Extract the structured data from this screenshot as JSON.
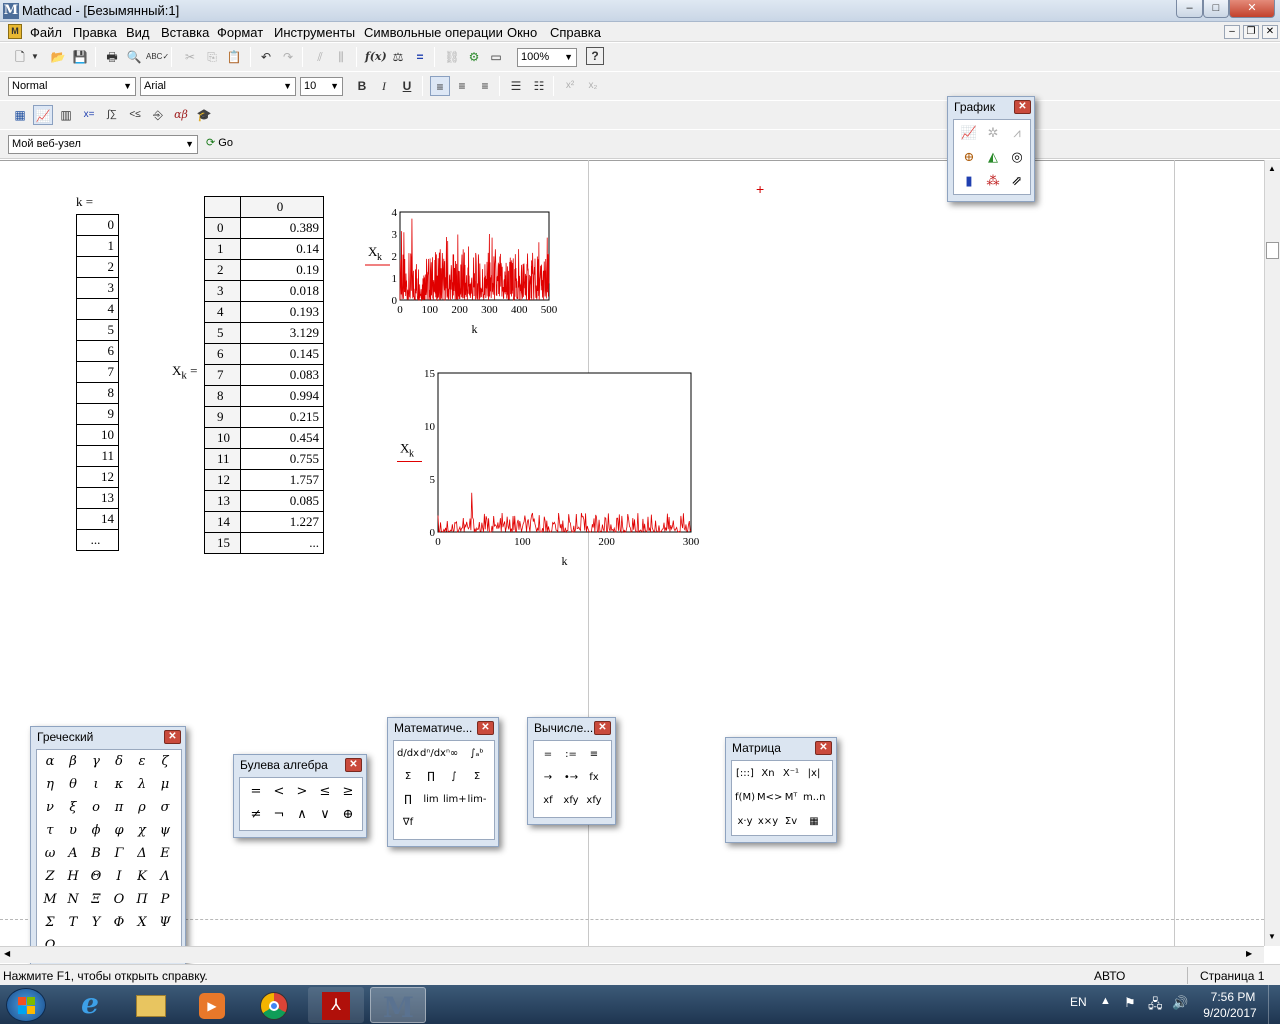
{
  "window": {
    "title": "Mathcad - [Безымянный:1]",
    "app_icon": "M",
    "controls": [
      "–",
      "□",
      "✕"
    ]
  },
  "menu": [
    "Файл",
    "Правка",
    "Вид",
    "Вставка",
    "Формат",
    "Инструменты",
    "Символьные операции",
    "Окно",
    "Справка"
  ],
  "toolbar1": {
    "zoom": "100%"
  },
  "format_bar": {
    "style": "Normal",
    "font": "Arial",
    "size": "10",
    "bold": "B",
    "italic": "I",
    "underline": "U"
  },
  "web_bar": {
    "url": "Мой веб-узел",
    "go": "Go"
  },
  "worksheet": {
    "k_label": "k =",
    "k_values": [
      "0",
      "1",
      "2",
      "3",
      "4",
      "5",
      "6",
      "7",
      "8",
      "9",
      "10",
      "11",
      "12",
      "13",
      "14",
      "..."
    ],
    "x_label": "X",
    "x_sub": "k",
    "x_eq": "=",
    "x_header_row": [
      "",
      "0"
    ],
    "x_rows": [
      [
        "0",
        "0.389"
      ],
      [
        "1",
        "0.14"
      ],
      [
        "2",
        "0.19"
      ],
      [
        "3",
        "0.018"
      ],
      [
        "4",
        "0.193"
      ],
      [
        "5",
        "3.129"
      ],
      [
        "6",
        "0.145"
      ],
      [
        "7",
        "0.083"
      ],
      [
        "8",
        "0.994"
      ],
      [
        "9",
        "0.215"
      ],
      [
        "10",
        "0.454"
      ],
      [
        "11",
        "0.755"
      ],
      [
        "12",
        "1.757"
      ],
      [
        "13",
        "0.085"
      ],
      [
        "14",
        "1.227"
      ],
      [
        "15",
        "..."
      ]
    ]
  },
  "chart_data": [
    {
      "type": "line",
      "xlabel": "k",
      "ylabel": "X",
      "ylabel_sub": "k",
      "xlim": [
        0,
        500
      ],
      "ylim": [
        0,
        4
      ],
      "xticks": [
        "0",
        "100",
        "200",
        "300",
        "400",
        "500"
      ],
      "yticks": [
        "0",
        "1",
        "2",
        "3",
        "4"
      ],
      "series_color": "#e00000",
      "peaks": [
        {
          "x": 5,
          "y": 3.129
        },
        {
          "x": 40,
          "y": 3.7
        },
        {
          "x": 300,
          "y": 3.0
        }
      ]
    },
    {
      "type": "line",
      "xlabel": "k",
      "ylabel": "X",
      "ylabel_sub": "k",
      "xlim": [
        0,
        300
      ],
      "ylim": [
        0,
        15
      ],
      "xticks": [
        "0",
        "100",
        "200",
        "300"
      ],
      "yticks": [
        "0",
        "5",
        "10",
        "15"
      ],
      "series_color": "#e00000",
      "peaks": [
        {
          "x": 40,
          "y": 3.7
        }
      ]
    }
  ],
  "palettes": {
    "graph": {
      "title": "График"
    },
    "greek": {
      "title": "Греческий",
      "symbols": [
        "α",
        "β",
        "γ",
        "δ",
        "ε",
        "ζ",
        "η",
        "θ",
        "ι",
        "κ",
        "λ",
        "μ",
        "ν",
        "ξ",
        "ο",
        "π",
        "ρ",
        "σ",
        "τ",
        "υ",
        "ϕ",
        "φ",
        "χ",
        "ψ",
        "ω",
        "Α",
        "Β",
        "Γ",
        "Δ",
        "Ε",
        "Ζ",
        "Η",
        "Θ",
        "Ι",
        "Κ",
        "Λ",
        "Μ",
        "Ν",
        "Ξ",
        "Ο",
        "Π",
        "Ρ",
        "Σ",
        "Τ",
        "Υ",
        "Φ",
        "Χ",
        "Ψ",
        "Ω"
      ]
    },
    "boolean": {
      "title": "Булева алгебра",
      "symbols": [
        "=",
        "<",
        ">",
        "≤",
        "≥",
        "≠",
        "¬",
        "∧",
        "∨",
        "⊕"
      ]
    },
    "calculus": {
      "title": "Математиче...",
      "symbols": [
        "d/dx",
        "dⁿ/dxⁿ",
        "∞",
        "∫ₐᵇ",
        "Σ",
        "∏",
        "∫",
        "Σ",
        "∏",
        "lim",
        "lim+",
        "lim-",
        "∇f"
      ]
    },
    "evaluation": {
      "title": "Вычисле...",
      "symbols": [
        "=",
        ":=",
        "≡",
        "→",
        "•→",
        "fx",
        "xf",
        "xfy",
        "xfy"
      ]
    },
    "matrix": {
      "title": "Матрица",
      "symbols": [
        "[:::]",
        "Xn",
        "X⁻¹",
        "|x|",
        "f(M)",
        "M<>",
        "Mᵀ",
        "m..n",
        "x·y",
        "x×y",
        "Σv",
        "▦"
      ]
    }
  },
  "status": {
    "hint": "Нажмите F1, чтобы открыть справку.",
    "mode": "АВТО",
    "page": "Страница 1"
  },
  "taskbar": {
    "lang": "EN",
    "time": "7:56 PM",
    "date": "9/20/2017"
  }
}
